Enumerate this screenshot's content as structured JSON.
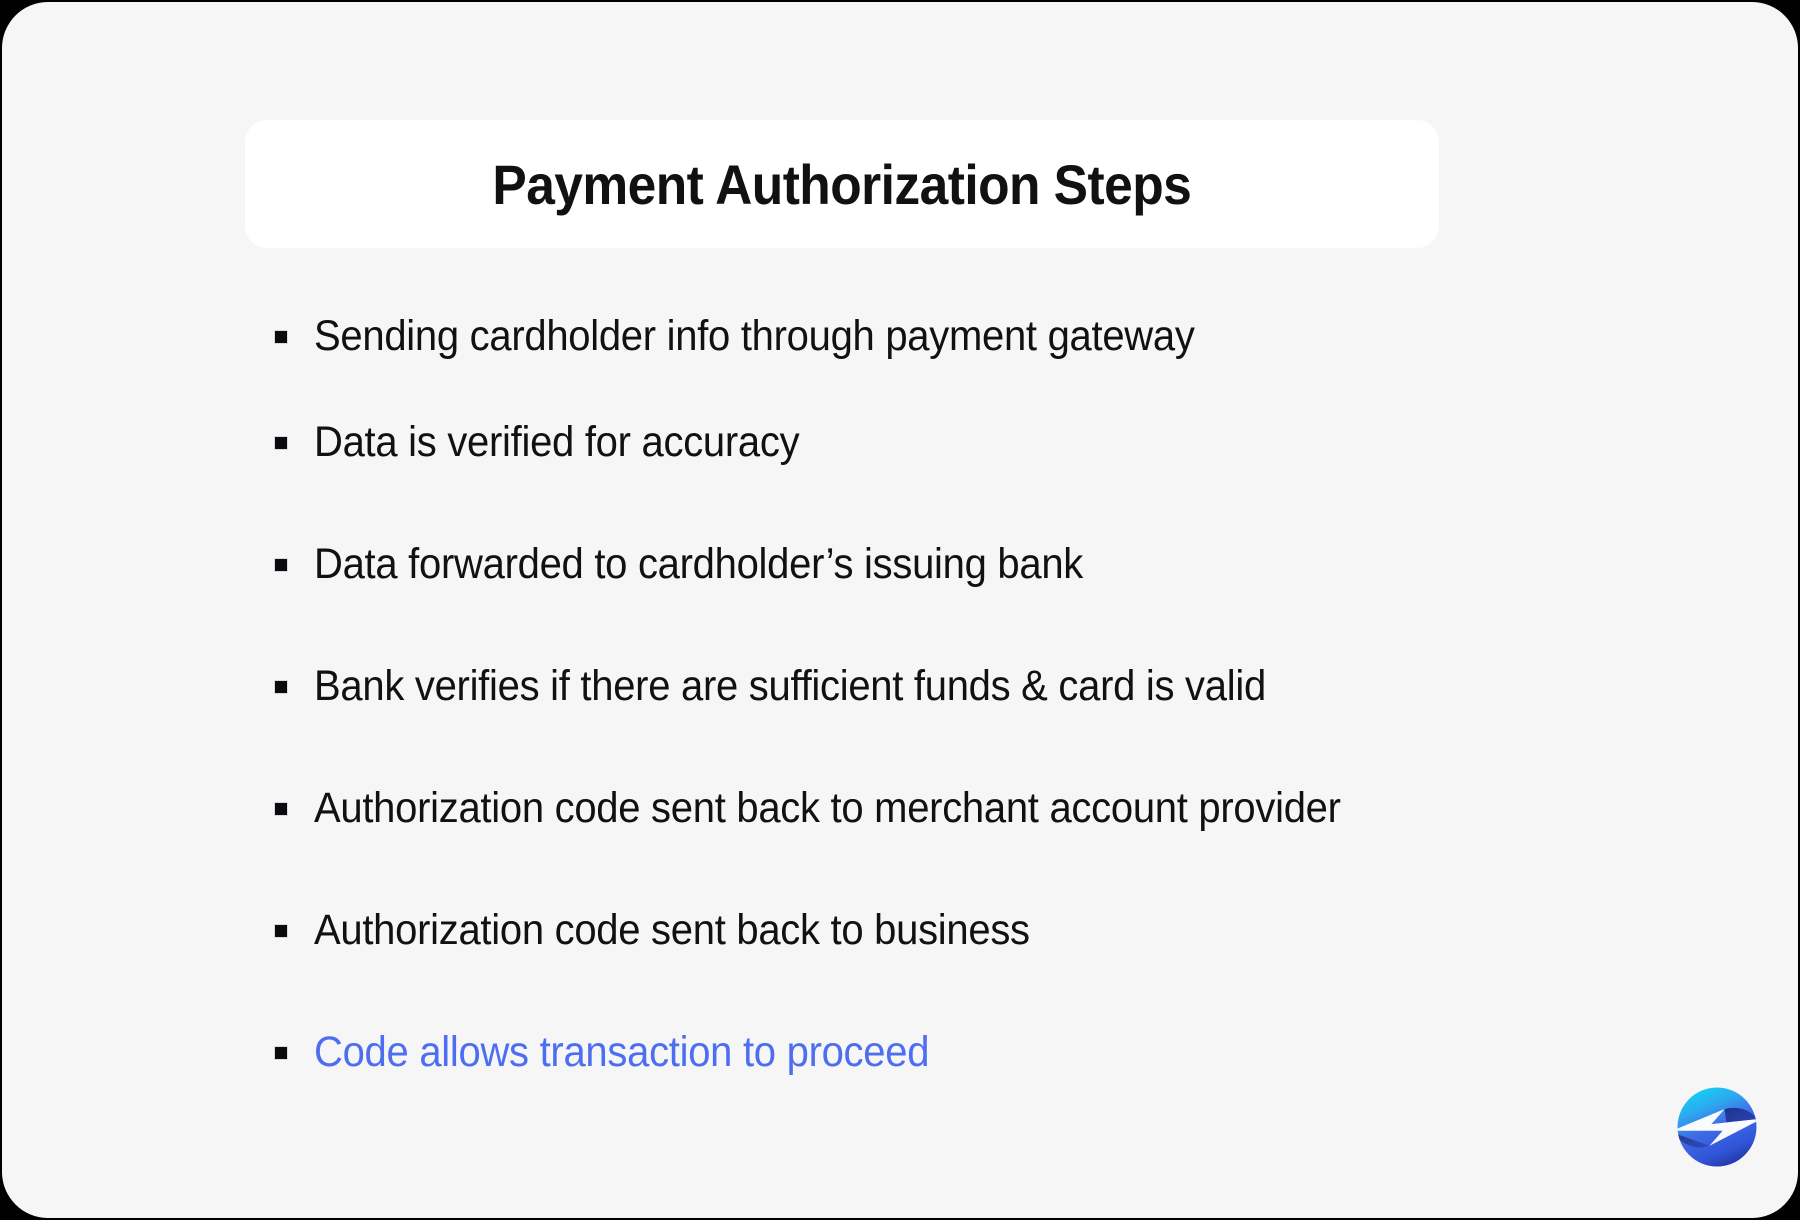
{
  "header": {
    "title": "Payment Authorization Steps"
  },
  "steps": {
    "items": [
      {
        "label": "Sending cardholder info through payment gateway",
        "accent": false
      },
      {
        "label": "Data is verified for accuracy",
        "accent": false
      },
      {
        "label": "Data forwarded to cardholder’s issuing bank",
        "accent": false
      },
      {
        "label": "Bank verifies if there are sufficient funds & card is valid",
        "accent": false
      },
      {
        "label": "Authorization code sent back to merchant account provider",
        "accent": false
      },
      {
        "label": "Authorization code sent back to business",
        "accent": false
      },
      {
        "label": "Code allows transaction to proceed",
        "accent": true
      }
    ]
  },
  "brand": {
    "logo_icon": "lightning-bolt-circle-logo"
  },
  "colors": {
    "page_background": "#000000",
    "card_background": "#F6F6F7",
    "title_card_background": "#FFFFFF",
    "text": "#111113",
    "accent_text": "#4E6EF2",
    "connector_top": "#45D6EC",
    "connector_bottom": "#6B8AF0",
    "bullet": "#0B0B0D",
    "logo_gradient_start": "#22C8F0",
    "logo_gradient_mid": "#3E6BE8",
    "logo_gradient_end": "#23307A"
  }
}
